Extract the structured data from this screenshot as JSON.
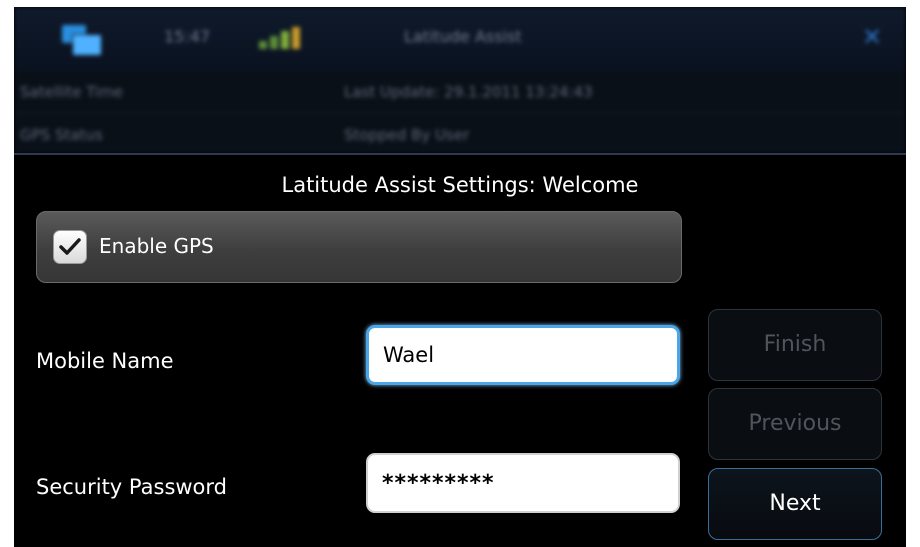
{
  "background_app": {
    "time": "15:47",
    "title": "Latitude Assist",
    "rows": [
      {
        "label": "Satellite Time",
        "value": "Last Update: 29.1.2011 13:24:43"
      },
      {
        "label": "GPS Status",
        "value": "Stopped By User"
      }
    ]
  },
  "dialog": {
    "title": "Latitude Assist Settings: Welcome",
    "enable_gps": {
      "label": "Enable GPS",
      "checked": true
    },
    "mobile_name": {
      "label": "Mobile Name",
      "value": "Wael"
    },
    "security_password": {
      "label": "Security Password",
      "value": "*********"
    },
    "buttons": {
      "finish": "Finish",
      "previous": "Previous",
      "next": "Next"
    }
  },
  "colors": {
    "accent_focus": "#4aa6e6",
    "disabled_text": "#4f555c",
    "dialog_bg": "#000000"
  }
}
